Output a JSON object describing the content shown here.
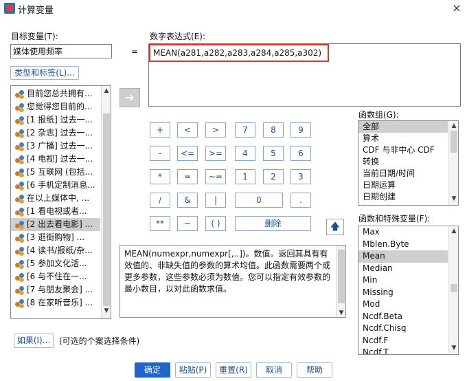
{
  "window": {
    "title": "计算变量",
    "close_glyph": "×"
  },
  "target": {
    "label": "目标变量(T):",
    "value": "媒体使用频率",
    "type_label_button": "类型和标签(L)..."
  },
  "equals": "=",
  "expression": {
    "label": "数字表达式(E):",
    "value": "MEAN(a281,a282,a283,a284,a285,a302)"
  },
  "variables": [
    "目前您总共拥有...",
    "您觉得您目前的...",
    "[1 报纸]  过去一...",
    "[2 杂志]  过去一...",
    "[3 广播]  过去一...",
    "[4 电视]  过去一...",
    "[5 互联网 (包括...",
    "[6 手机定制消息...",
    "在以上媒体中, ...",
    "[1  看电视或者...",
    "[2 出去看电影] ...",
    "[3  逛街购物]  ...",
    "[4  读书/报纸/杂...",
    "[5  参加文化活...",
    "[6  与不住在一...",
    "[7  与朋友聚会]  ...",
    "[8  在家听音乐]  ..."
  ],
  "selected_variable_index": 10,
  "keypad": {
    "row1": [
      "+",
      "<",
      ">",
      "7",
      "8",
      "9"
    ],
    "row2": [
      "-",
      "<=",
      ">=",
      "4",
      "5",
      "6"
    ],
    "row3": [
      "*",
      "=",
      "~=",
      "1",
      "2",
      "3"
    ],
    "row4": [
      "/",
      "&",
      "|",
      "0",
      "."
    ],
    "row5": [
      "**",
      "~",
      "( )",
      "删除"
    ]
  },
  "function_group": {
    "label": "函数组(G):",
    "items": [
      "全部",
      "算术",
      "CDF 与非中心 CDF",
      "转换",
      "当前日期/时间",
      "日期运算",
      "日期创建"
    ],
    "selected_index": 0
  },
  "functions": {
    "label": "函数和特殊变量(F):",
    "items": [
      "Max",
      "Mblen.Byte",
      "Mean",
      "Median",
      "Min",
      "Missing",
      "Mod",
      "Ncdf.Beta",
      "Ncdf.Chisq",
      "Ncdf.F",
      "Ncdf.T"
    ],
    "selected_index": 2
  },
  "description": "MEAN(numexpr,numexpr[,..])。数值。返回其具有有效值的、非缺失值的参数的算术均值。此函数需要两个或更多参数，这些参数必须为数值。您可以指定有效参数的最小数目，以对此函数求值。",
  "if_button": "如果(I)...",
  "if_hint": "(可选的个案选择条件)",
  "buttons": {
    "ok": "确定",
    "paste": "粘贴(P)",
    "reset": "重置(R)",
    "cancel": "取消",
    "help": "帮助"
  },
  "icons": {
    "transfer": "left-arrow-icon",
    "up": "up-arrow-icon"
  }
}
